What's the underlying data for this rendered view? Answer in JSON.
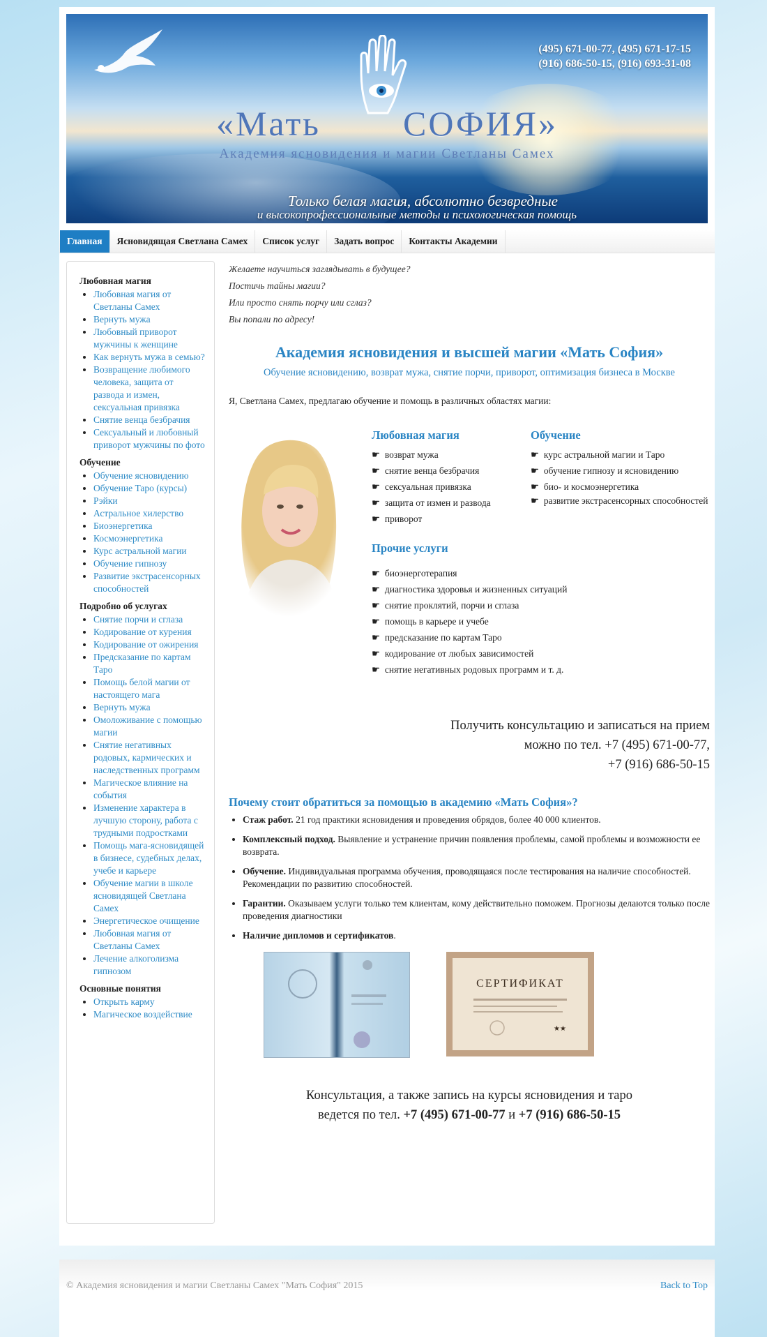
{
  "header": {
    "phones_line1": "(495) 671-00-77, (495) 671-17-15",
    "phones_line2": "(916) 686-50-15, (916) 693-31-08",
    "logo_left": "«Мать",
    "logo_right": "СОФИЯ»",
    "logo_subtitle": "Академия ясновидения и магии Светланы Самех",
    "slogan_line1": "Только белая магия, абсолютно безвредные",
    "slogan_line2": "и высокопрофессиональные методы и психологическая помощь"
  },
  "nav": [
    {
      "label": "Главная",
      "active": true
    },
    {
      "label": "Ясновидящая Светлана Самех",
      "active": false
    },
    {
      "label": "Список услуг",
      "active": false
    },
    {
      "label": "Задать вопрос",
      "active": false
    },
    {
      "label": "Контакты Академии",
      "active": false
    }
  ],
  "sidebar": {
    "sections": [
      {
        "title": "Любовная магия",
        "items": [
          "Любовная магия от Светланы Самех",
          "Вернуть мужа",
          "Любовный приворот мужчины к женщине",
          "Как вернуть мужа в семью?",
          "Возвращение любимого человека, защита от развода и измен, сексуальная привязка",
          "Снятие венца безбрачия",
          "Сексуальный и любовный приворот мужчины по фото"
        ]
      },
      {
        "title": "Обучение",
        "items": [
          "Обучение ясновидению",
          "Обучение Таро (курсы)",
          "Рэйки",
          "Астральное хилерство",
          "Биоэнергетика",
          "Космоэнергетика",
          "Курс астральной магии",
          "Обучение гипнозу",
          "Развитие экстрасенсорных способностей"
        ]
      },
      {
        "title": "Подробно об услугах",
        "items": [
          "Снятие порчи и сглаза",
          "Кодирование от курения",
          "Кодирование от ожирения",
          "Предсказание по картам Таро",
          "Помощь белой магии от настоящего мага",
          "Вернуть мужа",
          "Омоложивание с помощью магии",
          "Снятие негативных родовых, кармических и наследственных программ",
          "Магическое влияние на события",
          "Изменение характера в лучшую сторону, работа с трудными подростками",
          "Помощь мага-ясновидящей в бизнесе, судебных делах, учебе и карьере",
          "Обучение магии в школе ясновидящей Светлана Самех",
          "Энергетическое очищение",
          "Любовная магия от Светланы Самех",
          "Лечение алкоголизма гипнозом"
        ]
      },
      {
        "title": "Основные понятия",
        "items": [
          "Открыть карму",
          "Магическое воздействие"
        ]
      }
    ]
  },
  "main": {
    "intro": [
      "Желаете научиться заглядывать в будущее?",
      "Постичь тайны магии?",
      "Или просто снять порчу или сглаз?",
      "Вы попали по адресу!"
    ],
    "heading": "Академия ясновидения и высшей магии «Мать София»",
    "subheading": "Обучение ясновидению, возврат мужа, снятие порчи, приворот, оптимизация бизнеса в Москве",
    "lead": "Я, Светлана Самех, предлагаю обучение и помощь в различных областях магии:",
    "love": {
      "title": "Любовная магия",
      "items": [
        "возврат мужа",
        "снятие венца безбрачия",
        "сексуальная привязка",
        "защита от измен и развода",
        "приворот"
      ]
    },
    "study": {
      "title": "Обучение",
      "items": [
        "курс астральной магии и Таро",
        "обучение гипнозу и ясновидению",
        "био- и космоэнергетика",
        "развитие экстрасенсорных способностей"
      ]
    },
    "other": {
      "title": "Прочие услуги",
      "items": [
        "биоэнерготерапия",
        "диагностика здоровья и жизненных ситуаций",
        "снятие проклятий, порчи и сглаза",
        "помощь в карьере и учебе",
        "предсказание по картам Таро",
        "кодирование от любых зависимостей",
        "снятие негативных родовых программ и т. д."
      ]
    },
    "consult": [
      "Получить консультацию и записаться на прием",
      "можно по тел. +7 (495) 671-00-77,",
      "+7 (916) 686-50-15"
    ],
    "why_title": "Почему стоит обратиться за помощью в академию «Мать София»?",
    "why": [
      {
        "bold": "Стаж работ.",
        "text": " 21 год практики ясновидения и проведения обрядов, более 40 000 клиентов."
      },
      {
        "bold": "Комплексный подход.",
        "text": " Выявление и устранение причин появления проблемы, самой проблемы и возможности ее возврата."
      },
      {
        "bold": "Обучение.",
        "text": " Индивидуальная программа обучения, проводящаяся после тестирования на наличие способностей. Рекомендации по развитию способностей."
      },
      {
        "bold": "Гарантии.",
        "text": " Оказываем услуги только тем клиентам, кому действительно поможем. Прогнозы делаются только после проведения диагностики"
      },
      {
        "bold": "Наличие дипломов и сертификатов",
        "text": "."
      }
    ],
    "certificate_label": "СЕРТИФИКАТ",
    "final_line1": "Консультация, а также запись на курсы ясновидения и таро",
    "final_line2_prefix": "ведется по тел. ",
    "final_phone1": "+7 (495) 671-00-77",
    "final_and": " и ",
    "final_phone2": "+7 (916) 686-50-15"
  },
  "footer": {
    "copyright": "© Академия ясновидения и магии Светланы Самех \"Мать София\" 2015",
    "back_to_top": "Back to Top"
  },
  "colors": {
    "accent": "#2a85c4",
    "nav_active": "#1e7ec4",
    "footer_text": "#999999"
  }
}
